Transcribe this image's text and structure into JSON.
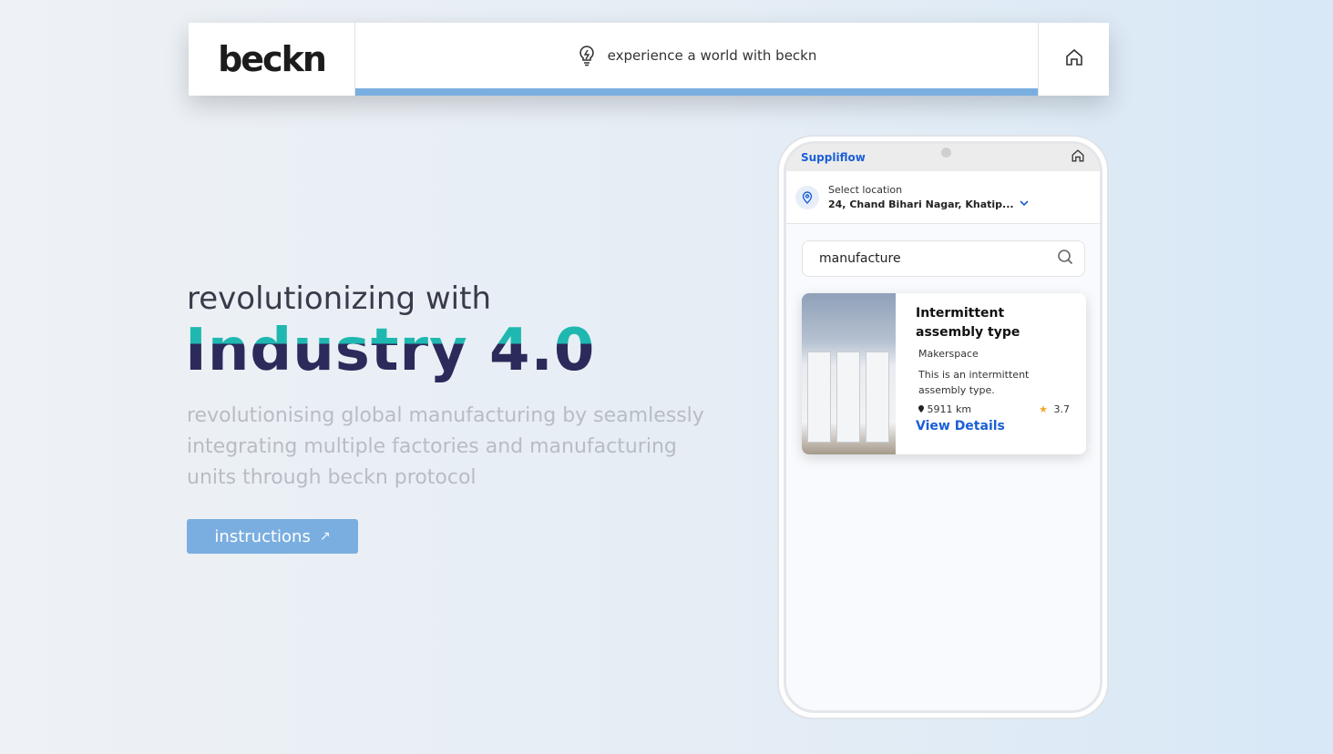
{
  "header": {
    "logo": "beckn",
    "tagline": "experience a world with beckn",
    "progress_fraction": 1.0
  },
  "hero": {
    "subtitle": "revolutionizing with",
    "title": "Industry 4.0",
    "description": "revolutionising global manufacturing by seamlessly integrating multiple factories and manufacturing units through beckn protocol",
    "button_label": "instructions",
    "button_arrow": "↗"
  },
  "phone": {
    "brand": "Suppliflow",
    "location_label": "Select location",
    "location_value": "24, Chand Bihari Nagar, Khatip...",
    "search_value": "manufacture",
    "card": {
      "title": "Intermittent assembly type",
      "provider": "Makerspace",
      "description": "This is an intermittent assembly type.",
      "distance": "5911 km",
      "rating": "3.7",
      "link": "View Details"
    }
  },
  "colors": {
    "accent": "#7aaee0",
    "brand_blue": "#1b5fd6",
    "teal": "#1fb8b0",
    "navy": "#2b2a5a"
  },
  "icons": [
    "bulb-icon",
    "home-icon",
    "location-pin-icon",
    "chevron-down-icon",
    "search-icon",
    "star-icon",
    "arrow-up-right-icon"
  ]
}
